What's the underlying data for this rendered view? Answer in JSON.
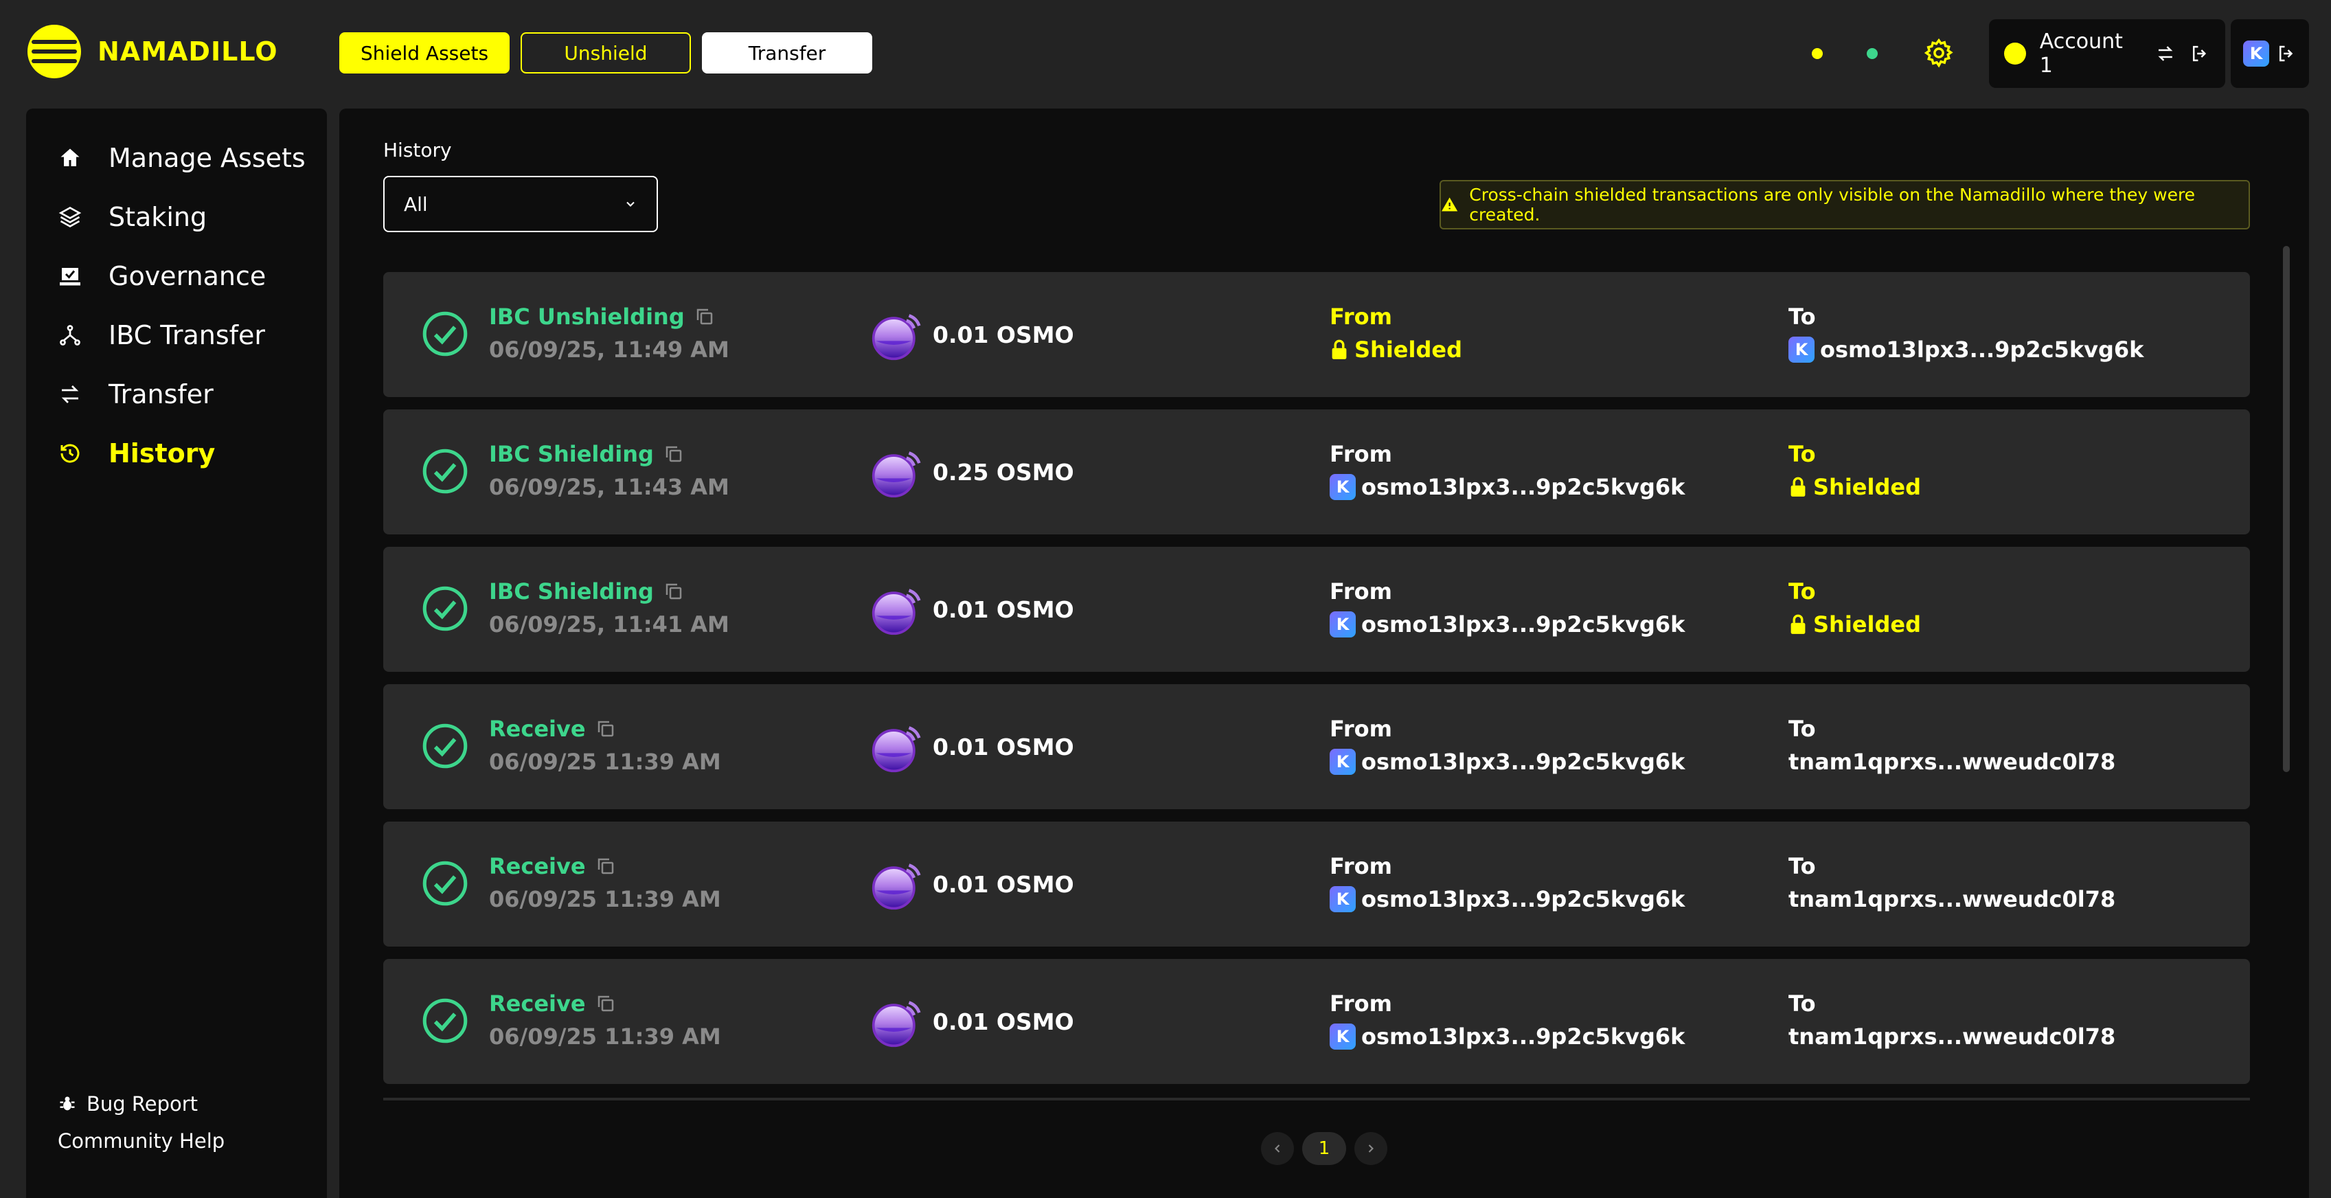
{
  "app": {
    "name": "NAMADILLO"
  },
  "header": {
    "shield_assets": "Shield Assets",
    "unshield": "Unshield",
    "transfer": "Transfer",
    "account_name": "Account 1",
    "extension_badge": "K"
  },
  "colors": {
    "accent": "#FFFF00",
    "success": "#3DD68C",
    "panel": "#0D0D0D",
    "row": "#2A2A2A",
    "background": "#232323"
  },
  "sidebar": {
    "items": [
      {
        "label": "Manage Assets",
        "icon": "home-icon"
      },
      {
        "label": "Staking",
        "icon": "layers-icon"
      },
      {
        "label": "Governance",
        "icon": "ballot-icon"
      },
      {
        "label": "IBC Transfer",
        "icon": "network-icon"
      },
      {
        "label": "Transfer",
        "icon": "arrows-icon"
      },
      {
        "label": "History",
        "icon": "history-icon",
        "active": true
      }
    ],
    "footer": {
      "bug_report": "Bug Report",
      "community_help": "Community Help"
    }
  },
  "history": {
    "label": "History",
    "filter_value": "All",
    "notice": "Cross-chain shielded transactions are only visible on the Namadillo where they were created.",
    "transactions": [
      {
        "type": "IBC Unshielding",
        "date": "06/09/25, 11:49 AM",
        "amount": "0.01 OSMO",
        "from_label": "From",
        "from": "Shielded",
        "to_label": "To",
        "to": "osmo13lpx3...9p2c5kvg6k"
      },
      {
        "type": "IBC Shielding",
        "date": "06/09/25, 11:43 AM",
        "amount": "0.25 OSMO",
        "from_label": "From",
        "from": "osmo13lpx3...9p2c5kvg6k",
        "to_label": "To",
        "to": "Shielded"
      },
      {
        "type": "IBC Shielding",
        "date": "06/09/25, 11:41 AM",
        "amount": "0.01 OSMO",
        "from_label": "From",
        "from": "osmo13lpx3...9p2c5kvg6k",
        "to_label": "To",
        "to": "Shielded"
      },
      {
        "type": "Receive",
        "date": "06/09/25 11:39 AM",
        "amount": "0.01 OSMO",
        "from_label": "From",
        "from": "osmo13lpx3...9p2c5kvg6k",
        "to_label": "To",
        "to": "tnam1qprxs...wweudc0l78"
      },
      {
        "type": "Receive",
        "date": "06/09/25 11:39 AM",
        "amount": "0.01 OSMO",
        "from_label": "From",
        "from": "osmo13lpx3...9p2c5kvg6k",
        "to_label": "To",
        "to": "tnam1qprxs...wweudc0l78"
      },
      {
        "type": "Receive",
        "date": "06/09/25 11:39 AM",
        "amount": "0.01 OSMO",
        "from_label": "From",
        "from": "osmo13lpx3...9p2c5kvg6k",
        "to_label": "To",
        "to": "tnam1qprxs...wweudc0l78"
      }
    ],
    "pagination": {
      "current_page": "1"
    }
  }
}
